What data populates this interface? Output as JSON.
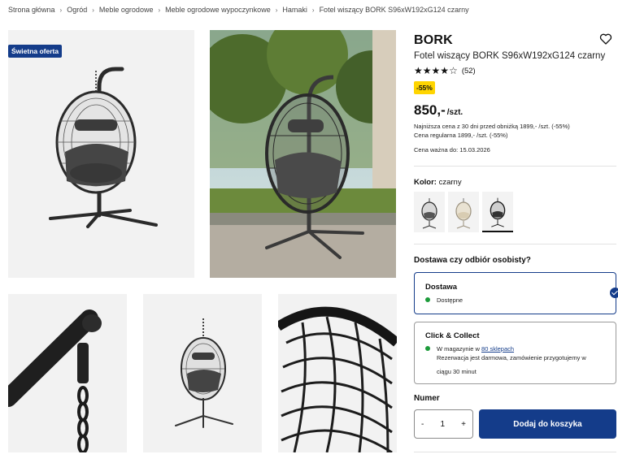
{
  "breadcrumb": [
    "Strona główna",
    "Ogród",
    "Meble ogrodowe",
    "Meble ogrodowe wypoczynkowe",
    "Hamaki",
    "Fotel wiszący BORK S96xW192xG124 czarny"
  ],
  "gallery": {
    "badge": "Świetna oferta",
    "images": [
      "product-photo-white-background",
      "product-photo-garden",
      "closeup-hook-chain",
      "product-photo-small",
      "closeup-wicker-weave"
    ]
  },
  "product": {
    "brand": "BORK",
    "name": "Fotel wiszący BORK S96xW192xG124 czarny",
    "rating_value": 4,
    "rating_max": 5,
    "rating_count": "(52)",
    "discount": "-55%",
    "price": "850,-",
    "price_unit": "/szt.",
    "lowest_price_note": "Najniższa cena z 30 dni przed obniżką 1899,- /szt. (-55%)",
    "regular_price_note": "Cena regularna 1899,- /szt. (-55%)",
    "valid_until": "Cena ważna do: 15.03.2026"
  },
  "color": {
    "label": "Kolor:",
    "value": "czarny",
    "swatches": [
      "czarny-szary",
      "beżowy",
      "czarny"
    ],
    "selected_index": 2
  },
  "delivery": {
    "title": "Dostawa czy odbiór osobisty?",
    "options": [
      {
        "title": "Dostawa",
        "status": "Dostępne",
        "selected": true
      },
      {
        "title": "Click & Collect",
        "status_prefix": "W magazynie w ",
        "status_link": "80 sklepach",
        "note_line1": "Rezerwacja jest darmowa, zamówienie przygotujemy w",
        "note_line2": "ciągu 30 minut",
        "selected": false
      }
    ]
  },
  "quantity": {
    "label": "Numer",
    "minus": "-",
    "value": "1",
    "plus": "+"
  },
  "cart": {
    "add_label": "Dodaj do koszyka"
  },
  "colors": {
    "primary": "#143c8a",
    "sale_yellow": "#ffd500",
    "stock_green": "#1c9b3a",
    "badge_navy": "#143c8a"
  }
}
